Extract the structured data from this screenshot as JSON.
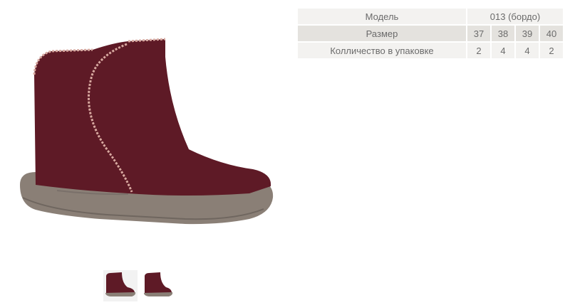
{
  "product": {
    "image_alt": "",
    "thumbnails": [
      "thumb-1",
      "thumb-2"
    ]
  },
  "specs": {
    "model_label": "Модель",
    "model_value": "013 (бордо)",
    "size_label": "Размер",
    "sizes": [
      "37",
      "38",
      "39",
      "40"
    ],
    "qty_label": "Колличество в упаковке",
    "quantities": [
      "2",
      "4",
      "4",
      "2"
    ]
  },
  "colors": {
    "felt": "#5e1a26",
    "sole": "#8a7f76",
    "stitch": "#d8a9a0",
    "table_light": "#f3f2f0",
    "table_dark": "#e4e2de",
    "text": "#6b6b6b"
  }
}
